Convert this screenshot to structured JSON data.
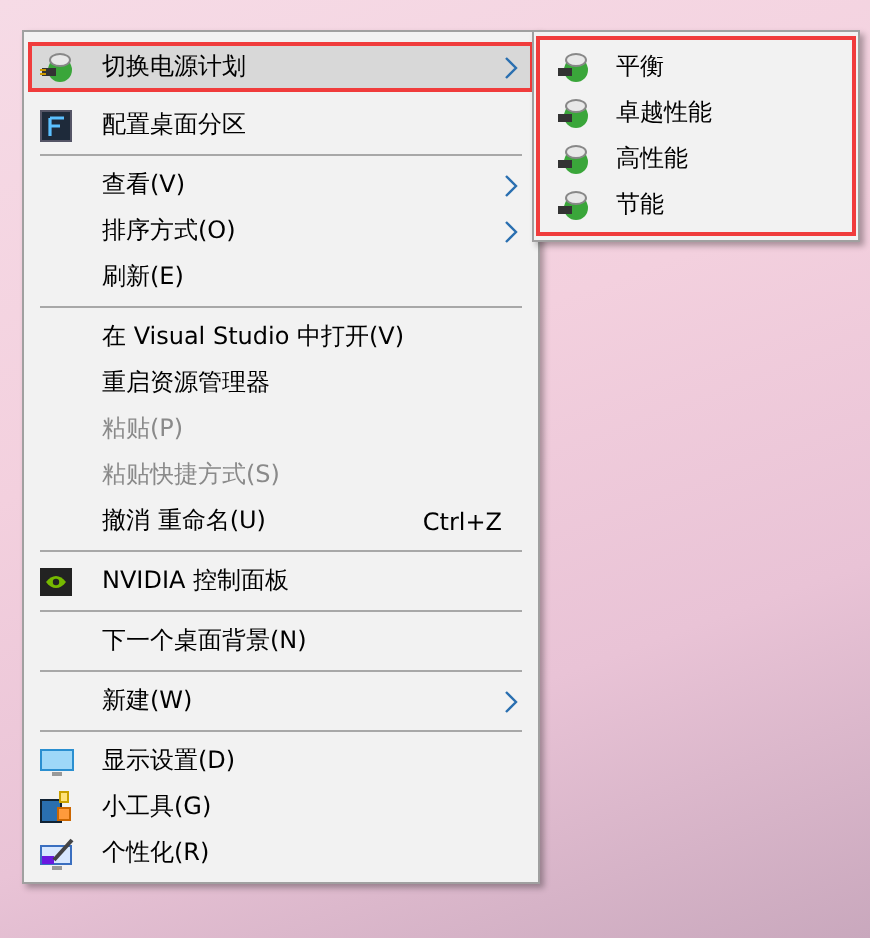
{
  "menu": {
    "items": [
      {
        "kind": "item",
        "label": "切换电源计划",
        "submenu": true,
        "selected": true,
        "annotated": true,
        "disabled": false
      },
      {
        "kind": "item",
        "label": "配置桌面分区",
        "submenu": false,
        "selected": false,
        "annotated": false,
        "disabled": false
      },
      {
        "kind": "separator"
      },
      {
        "kind": "item",
        "label": "查看(V)",
        "submenu": true,
        "selected": false,
        "annotated": false,
        "disabled": false
      },
      {
        "kind": "item",
        "label": "排序方式(O)",
        "submenu": true,
        "selected": false,
        "annotated": false,
        "disabled": false
      },
      {
        "kind": "item",
        "label": "刷新(E)",
        "submenu": false,
        "selected": false,
        "annotated": false,
        "disabled": false
      },
      {
        "kind": "separator"
      },
      {
        "kind": "item",
        "label": "在 Visual Studio 中打开(V)",
        "submenu": false,
        "selected": false,
        "annotated": false,
        "disabled": false
      },
      {
        "kind": "item",
        "label": "重启资源管理器",
        "submenu": false,
        "selected": false,
        "annotated": false,
        "disabled": false
      },
      {
        "kind": "item",
        "label": "粘贴(P)",
        "submenu": false,
        "selected": false,
        "annotated": false,
        "disabled": true
      },
      {
        "kind": "item",
        "label": "粘贴快捷方式(S)",
        "submenu": false,
        "selected": false,
        "annotated": false,
        "disabled": true
      },
      {
        "kind": "item",
        "label": "撤消 重命名(U)",
        "shortcut": "Ctrl+Z",
        "submenu": false,
        "selected": false,
        "annotated": false,
        "disabled": false
      },
      {
        "kind": "separator"
      },
      {
        "kind": "item",
        "label": "NVIDIA 控制面板",
        "submenu": false,
        "selected": false,
        "annotated": false,
        "disabled": false
      },
      {
        "kind": "separator"
      },
      {
        "kind": "item",
        "label": "下一个桌面背景(N)",
        "submenu": false,
        "selected": false,
        "annotated": false,
        "disabled": false
      },
      {
        "kind": "separator"
      },
      {
        "kind": "item",
        "label": "新建(W)",
        "submenu": true,
        "selected": false,
        "annotated": false,
        "disabled": false
      },
      {
        "kind": "separator"
      },
      {
        "kind": "item",
        "label": "显示设置(D)",
        "submenu": false,
        "selected": false,
        "annotated": false,
        "disabled": false
      },
      {
        "kind": "item",
        "label": "小工具(G)",
        "submenu": false,
        "selected": false,
        "annotated": false,
        "disabled": false
      },
      {
        "kind": "item",
        "label": "个性化(R)",
        "submenu": false,
        "selected": false,
        "annotated": false,
        "disabled": false
      }
    ]
  },
  "submenu": {
    "annotated": true,
    "items": [
      {
        "label": "平衡"
      },
      {
        "label": "卓越性能"
      },
      {
        "label": "高性能"
      },
      {
        "label": "节能"
      }
    ]
  }
}
